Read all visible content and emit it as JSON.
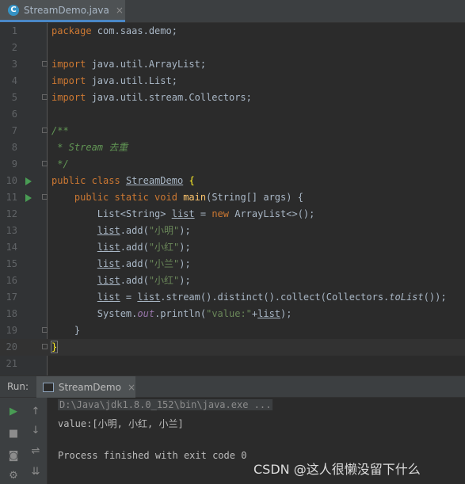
{
  "tab": {
    "title": "StreamDemo.java",
    "icon": "C",
    "close": "×"
  },
  "code": {
    "ln": [
      "1",
      "2",
      "3",
      "4",
      "5",
      "6",
      "7",
      "8",
      "9",
      "10",
      "11",
      "12",
      "13",
      "14",
      "15",
      "16",
      "17",
      "18",
      "19",
      "20",
      "21"
    ],
    "l1": {
      "kw": "package",
      "rest": " com.saas.demo;"
    },
    "l3": {
      "kw": "import",
      "rest": " java.util.ArrayList;"
    },
    "l4": {
      "kw": "import",
      "rest": " java.util.List;"
    },
    "l5": {
      "kw": "import",
      "rest": " java.util.stream.Collectors;"
    },
    "l7": "/**",
    "l8": " * Stream 去重",
    "l9": " */",
    "l10": {
      "kw1": "public",
      "kw2": "class",
      "name": "StreamDemo",
      "brace": "{"
    },
    "l11": {
      "kw": "public static void",
      "name": "main",
      "rest": "(String[] args) {"
    },
    "l12": {
      "type": "List<String> ",
      "var": "list",
      "eq": " = ",
      "new": "new",
      "rest": " ArrayList<>();"
    },
    "l13": {
      "var": "list",
      "mid": ".add(",
      "str": "\"小明\"",
      "end": ");"
    },
    "l14": {
      "var": "list",
      "mid": ".add(",
      "str": "\"小红\"",
      "end": ");"
    },
    "l15": {
      "var": "list",
      "mid": ".add(",
      "str": "\"小兰\"",
      "end": ");"
    },
    "l16": {
      "var": "list",
      "mid": ".add(",
      "str": "\"小红\"",
      "end": ");"
    },
    "l17": {
      "var": "list",
      "eq": " = ",
      "var2": "list",
      "mid": ".stream().distinct().collect(Collectors.",
      "fn": "toList",
      "end": "());"
    },
    "l18": {
      "pre": "System.",
      "out": "out",
      "mid": ".println(",
      "str": "\"value:\"",
      "plus": "+",
      "var": "list",
      "end": ");"
    },
    "l19": "}",
    "l20": "}"
  },
  "run": {
    "label": "Run:",
    "tab": "StreamDemo",
    "close": "×"
  },
  "console": {
    "cmd": "D:\\Java\\jdk1.8.0_152\\bin\\java.exe ...",
    "output": "value:[小明, 小红, 小兰]",
    "exit": "Process finished with exit code 0"
  },
  "toolbar": {
    "run": "▶",
    "up": "↑",
    "stop": "■",
    "down": "↓",
    "camera": "◙",
    "wrap": "⇌",
    "settings": "⚙",
    "sort": "⇊"
  },
  "watermark": "CSDN @这人很懒没留下什么",
  "colors": {
    "keyword": "#cc7832",
    "string": "#6a8759",
    "comment": "#629755",
    "method": "#ffc66d",
    "field": "#9876aa",
    "run_green": "#499c54"
  }
}
